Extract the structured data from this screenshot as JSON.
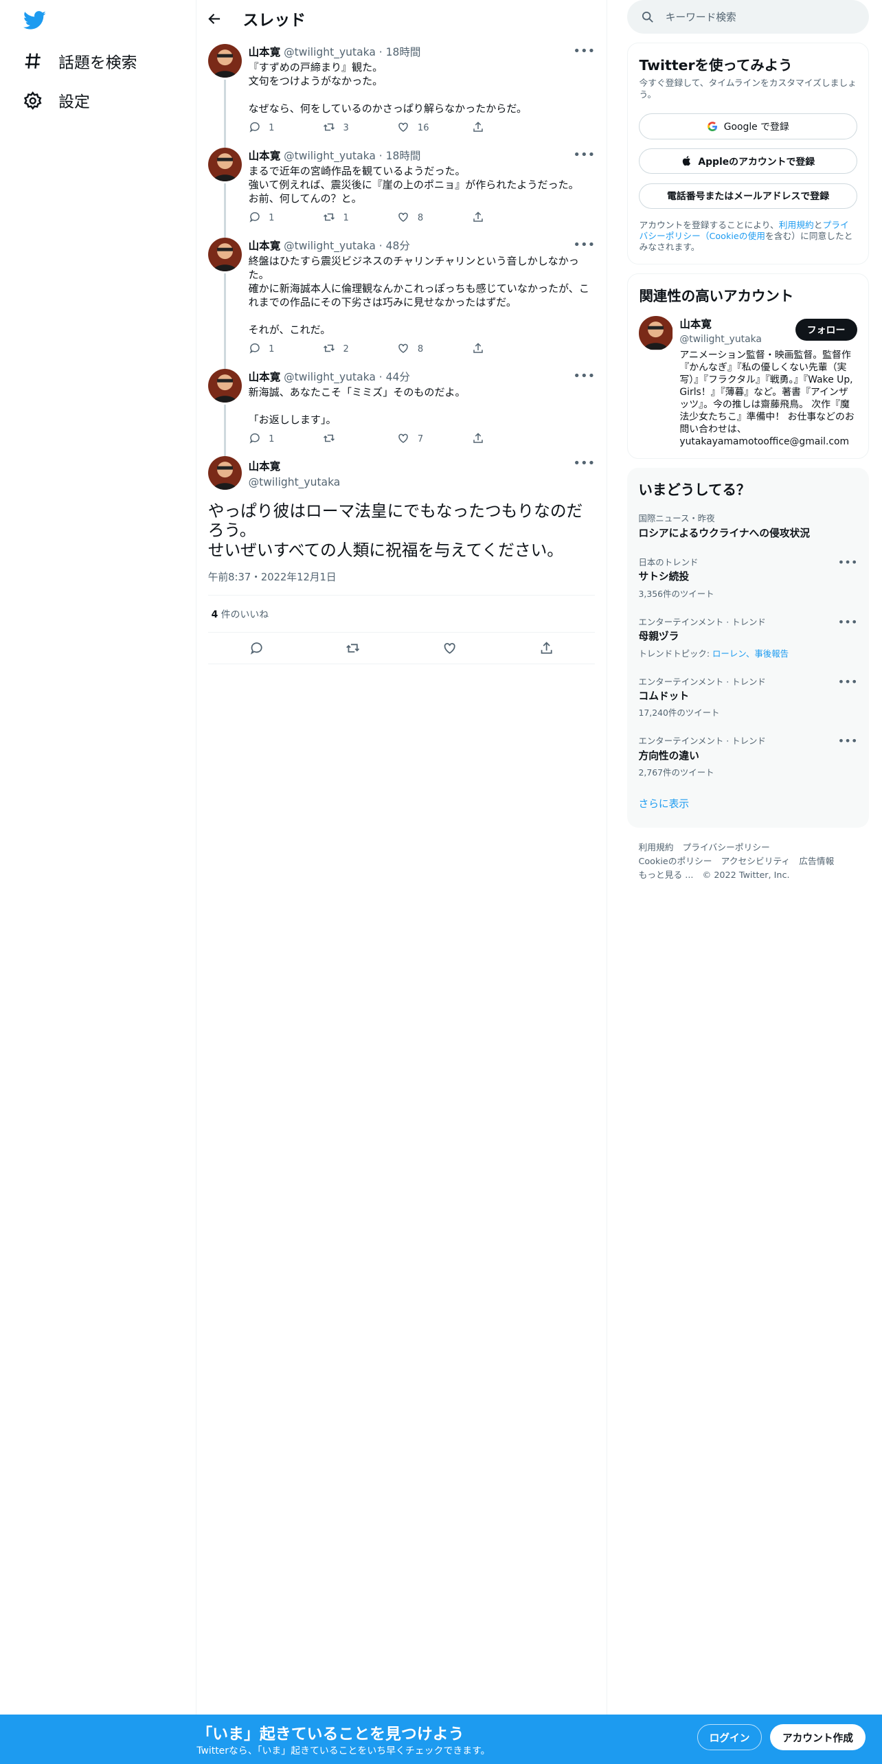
{
  "nav": {
    "items": [
      {
        "label": "話題を検索",
        "icon": "hashtag-icon"
      },
      {
        "label": "設定",
        "icon": "gear-icon"
      }
    ]
  },
  "header": {
    "title": "スレッド"
  },
  "thread": [
    {
      "name": "山本寛",
      "handle": "@twilight_yutaka",
      "time": "· 18時間",
      "text": "『すずめの戸締まり』観た。\n文句をつけようがなかった。\n\nなぜなら、何をしているのかさっぱり解らなかったからだ。",
      "reply": "1",
      "retweet": "3",
      "like": "16"
    },
    {
      "name": "山本寛",
      "handle": "@twilight_yutaka",
      "time": "· 18時間",
      "text": "まるで近年の宮崎作品を観ているようだった。\n強いて例えれば、震災後に『崖の上のポニョ』が作られたようだった。\nお前、何してんの？と。",
      "reply": "1",
      "retweet": "1",
      "like": "8"
    },
    {
      "name": "山本寛",
      "handle": "@twilight_yutaka",
      "time": "· 48分",
      "text": "終盤はひたすら震災ビジネスのチャリンチャリンという音しかしなかった。\n確かに新海誠本人に倫理観なんかこれっぽっちも感じていなかったが、これまでの作品にその下劣さは巧みに見せなかったはずだ。\n\nそれが、これだ。",
      "reply": "1",
      "retweet": "2",
      "like": "8"
    },
    {
      "name": "山本寛",
      "handle": "@twilight_yutaka",
      "time": "· 44分",
      "text": "新海誠、あなたこそ「ミミズ」そのものだよ。\n\n「お返しします」。",
      "reply": "1",
      "retweet": "",
      "like": "7"
    }
  ],
  "main_tweet": {
    "name": "山本寛",
    "handle": "@twilight_yutaka",
    "text": "やっぱり彼はローマ法皇にでもなったつもりなのだろう。\nせいぜいすべての人類に祝福を与えてください。",
    "timestamp": "午前8:37・2022年12月1日",
    "likes_count": "4",
    "likes_label": " 件のいいね"
  },
  "search": {
    "placeholder": "キーワード検索"
  },
  "signup": {
    "title": "Twitterを使ってみよう",
    "subtitle": "今すぐ登録して、タイムラインをカスタマイズしましょう。",
    "google": "Google で登録",
    "apple": "Appleのアカウントで登録",
    "phone": "電話番号またはメールアドレスで登録",
    "terms_pre": "アカウントを登録することにより、",
    "terms_link1": "利用規約",
    "terms_mid": "と",
    "terms_link2": "プライバシーポリシー（Cookieの使用",
    "terms_post": "を含む）に同意したとみなされます。"
  },
  "related": {
    "title": "関連性の高いアカウント",
    "name": "山本寛",
    "handle": "@twilight_yutaka",
    "follow": "フォロー",
    "bio": "アニメーション監督・映画監督。監督作『かんなぎ』『私の優しくない先輩（実写）』『フラクタル』『戦勇。』『Wake Up, Girls！』『薄暮』など。著書『アインザッツ』。今の推しは齋藤飛鳥。 次作『魔法少女たちこ』準備中！ お仕事などのお問い合わせは、yutakayamamotooffice@gmail.com"
  },
  "trends": {
    "title": "いまどうしてる？",
    "items": [
      {
        "context": "国際ニュース・昨夜",
        "name": "ロシアによるウクライナへの侵攻状況",
        "meta": "",
        "more": false
      },
      {
        "context": "日本のトレンド",
        "name": "サトシ続投",
        "meta": "3,356件のツイート",
        "more": true
      },
      {
        "context": "エンターテインメント · トレンド",
        "name": "母親ヅラ",
        "meta_pre": "トレンドトピック: ",
        "meta_link": "ローレン、事後報告",
        "more": true
      },
      {
        "context": "エンターテインメント · トレンド",
        "name": "コムドット",
        "meta": "17,240件のツイート",
        "more": true
      },
      {
        "context": "エンターテインメント · トレンド",
        "name": "方向性の違い",
        "meta": "2,767件のツイート",
        "more": true
      }
    ],
    "show_more": "さらに表示"
  },
  "footer": {
    "links": [
      "利用規約",
      "プライバシーポリシー",
      "Cookieのポリシー",
      "アクセシビリティ",
      "広告情報",
      "もっと見る ..."
    ],
    "copyright": "© 2022 Twitter, Inc."
  },
  "bottom_bar": {
    "title": "「いま」起きていることを見つけよう",
    "subtitle": "Twitterなら、「いま」起きていることをいち早くチェックできます。",
    "login": "ログイン",
    "signup": "アカウント作成"
  },
  "colors": {
    "accent": "#1d9bf0",
    "text": "#0f1419",
    "muted": "#536471"
  }
}
